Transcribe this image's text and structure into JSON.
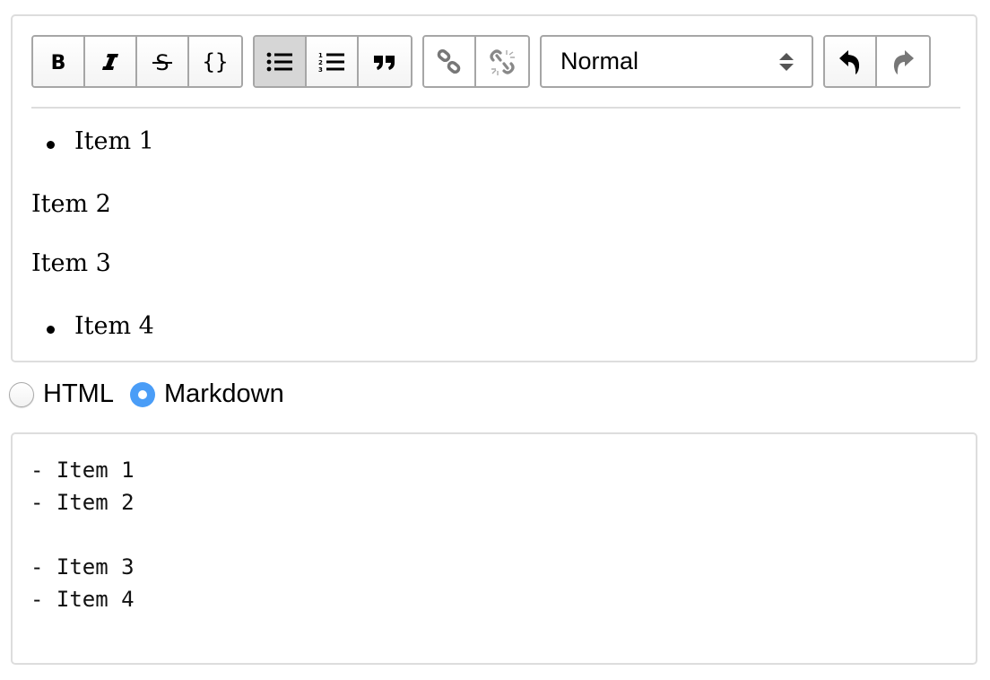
{
  "toolbar": {
    "groups": [
      {
        "buttons": [
          {
            "name": "bold",
            "label": "Bold",
            "icon": "bold-icon",
            "active": false,
            "enabled": true
          },
          {
            "name": "italic",
            "label": "Italic",
            "icon": "italic-icon",
            "active": false,
            "enabled": true
          },
          {
            "name": "strikethrough",
            "label": "Strikethrough",
            "icon": "strikethrough-icon",
            "active": false,
            "enabled": true
          },
          {
            "name": "code",
            "label": "Code",
            "icon": "code-braces-icon",
            "active": false,
            "enabled": true
          }
        ]
      },
      {
        "buttons": [
          {
            "name": "bullet-list",
            "label": "Bulleted list",
            "icon": "bullet-list-icon",
            "active": true,
            "enabled": true
          },
          {
            "name": "numbered-list",
            "label": "Numbered list",
            "icon": "numbered-list-icon",
            "active": false,
            "enabled": true
          },
          {
            "name": "blockquote",
            "label": "Blockquote",
            "icon": "quote-icon",
            "active": false,
            "enabled": true
          }
        ]
      },
      {
        "buttons": [
          {
            "name": "link",
            "label": "Link",
            "icon": "link-icon",
            "active": false,
            "enabled": false
          },
          {
            "name": "unlink",
            "label": "Unlink",
            "icon": "unlink-icon",
            "active": false,
            "enabled": false
          }
        ]
      },
      {
        "buttons": [
          {
            "name": "undo",
            "label": "Undo",
            "icon": "undo-icon",
            "active": false,
            "enabled": true
          },
          {
            "name": "redo",
            "label": "Redo",
            "icon": "redo-icon",
            "active": false,
            "enabled": false
          }
        ]
      }
    ],
    "block_type": {
      "selected": "Normal"
    }
  },
  "editor": {
    "blocks": [
      {
        "type": "bullet",
        "text": "Item 1"
      },
      {
        "type": "paragraph",
        "text": "Item 2"
      },
      {
        "type": "paragraph",
        "text": "Item 3"
      },
      {
        "type": "bullet",
        "text": "Item 4"
      }
    ]
  },
  "format": {
    "options": [
      {
        "label": "HTML",
        "checked": false
      },
      {
        "label": "Markdown",
        "checked": true
      }
    ],
    "accent_color": "#4a9df7"
  },
  "output": {
    "text": "- Item 1\n- Item 2\n\n- Item 3\n- Item 4"
  }
}
